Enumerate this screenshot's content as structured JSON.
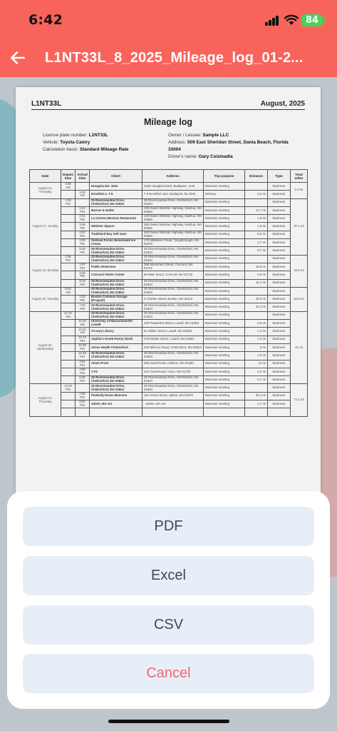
{
  "status": {
    "time": "6:42",
    "battery": "84"
  },
  "appbar": {
    "title": "L1NT33L_8_2025_Mileage_log_01-2..."
  },
  "doc": {
    "plate": "L1NT33L",
    "month": "August, 2025",
    "title": "Mileage log",
    "meta_left": [
      {
        "label": "License plate number: ",
        "value": "L1NT33L"
      },
      {
        "label": "Vehicle: ",
        "value": "Toyota Camry"
      },
      {
        "label": "Calculation basis: ",
        "value": "Standard Mileage Rate"
      }
    ],
    "meta_right": [
      {
        "label": "Owner / Lessee: ",
        "value": "Sample LLC"
      },
      {
        "label": "Address: ",
        "value": "509 East Sheridan Street, Dania Beach, Florida 33004"
      },
      {
        "label": "Driver's name: ",
        "value": "Gary Csizmadia"
      }
    ],
    "columns": [
      "Date",
      "Depart. time",
      "Arrival time",
      "Client",
      "Address",
      "Trip purpose",
      "Distance",
      "Type",
      "Total miles"
    ],
    "days": [
      {
        "date": "August 14, Thursday",
        "total": "3.3 mi",
        "rows": [
          [
            "2:38 AM",
            "Hungária krt. 163a",
            "163a Hungária körút, Budapest, 1146",
            "Business meeting",
            "",
            "Business"
          ],
          [
            "2:40 AM",
            "Erzsébet u. 7-9",
            "7-9 Erzsébet utca, Budapest, ba 1045",
            "Delivery",
            "3.3 mi",
            "Business"
          ]
        ]
      },
      {
        "date": "August 17, Sunday",
        "total": "37.1 mi",
        "rows": [
          [
            "1:08 PM",
            "25 Rivermeadow Drive, Chelmsford, MA 01824",
            "25 Rivermeadow Drive, Chelmsford, MA 01824",
            "Business meeting",
            "",
            "Business"
          ],
          [
            "1:24 PM",
            "Barnes & Noble",
            "235 Daniel Webster Highway, Nashua, NH 03060",
            "Business meeting",
            "11.7 mi",
            "Business"
          ],
          [
            "2:41 PM",
            "La Carreta Mexican Restaurant",
            "139 Daniel Webster Highway, Nashua, NH 03060",
            "Business meeting",
            "1.9 mi",
            "Business"
          ],
          [
            "3:48 PM",
            "Webster Square",
            "285 Daniel Webster Highway, Nashua, NH 03060",
            "Business meeting",
            "1.6 mi",
            "Business"
          ],
          [
            "4:22 PM",
            "Tradeland Buy Sell Save",
            "263 Daniel Webster Highway, Nashua, NH 03060",
            "Business meeting",
            "0.5 mi",
            "Business"
          ],
          [
            "4:39 PM",
            "Sullivan Farms Homemade Ice Cream",
            "170 Middlesex Road, Tyngsborough, MA 01879",
            "Business meeting",
            "2.7 mi",
            "Business"
          ],
          [
            "5:28 PM",
            "25 Rivermeadow Drive, Chelmsford, MA 01824",
            "25 Rivermeadow Drive, Chelmsford, MA 01824",
            "Business meeting",
            "8.7 mi",
            "Business"
          ]
        ]
      },
      {
        "date": "August 18, Monday",
        "total": "22.8 mi",
        "rows": [
          [
            "1:36 PM",
            "25 Rivermeadow Drive, Chelmsford, MA 01824",
            "25 Rivermeadow Drive, Chelmsford, MA 01824",
            "Business meeting",
            "",
            "Business"
          ],
          [
            "1:57 PM",
            "Public Restroom",
            "298 Monument Street, Concord, MA 01742",
            "Business meeting",
            "10.8 mi",
            "Business"
          ],
          [
            "2:26 PM",
            "Concord Visitor Center",
            "58 Main Street, Concord, MA 01742",
            "Business meeting",
            "0.9 mi",
            "Business"
          ],
          [
            "5:18 PM",
            "25 Rivermeadow Drive, Chelmsford, MA 01824",
            "25 Rivermeadow Drive, Chelmsford, MA 01824",
            "Business meeting",
            "11.1 mi",
            "Business"
          ]
        ]
      },
      {
        "date": "August 19, Tuesday",
        "total": "63.8 mi",
        "rows": [
          [
            "8:43 AM",
            "25 Rivermeadow Drive, Chelmsford, MA 01824",
            "25 Rivermeadow Drive, Chelmsford, MA 01824",
            "Business meeting",
            "",
            "Business"
          ],
          [
            "1:03 PM",
            "Boston Common Garage (Propark)",
            "0 Charles Street, Boston, MA 02116",
            "Business meeting",
            "32.6 mi",
            "Business"
          ],
          [
            "7:02 PM",
            "25 Rivermeadow Drive, Chelmsford, MA 01824",
            "25 Rivermeadow Drive, Chelmsford, MA 01824",
            "Business meeting",
            "31.2 mi",
            "Business"
          ]
        ]
      },
      {
        "date": "August 20, Wednesday",
        "total": "41 mi",
        "rows": [
          [
            "11:10 AM",
            "25 Rivermeadow Drive, Chelmsford, MA 01824",
            "25 Rivermeadow Drive, Chelmsford, MA 01824",
            "Business meeting",
            "",
            "Business"
          ],
          [
            "11:20 AM",
            "University of Massachusetts Lowell",
            "220 Pawtucket Street, Lowell, MA 01854",
            "Business meeting",
            "6.5 mi",
            "Business"
          ],
          [
            "11:54 AM",
            "O'Leary Library",
            "61 Wilder Street, Lowell, MA 01854",
            "Business meeting",
            "1.4 mi",
            "Business"
          ],
          [
            "12:13 PM",
            "Sophia's Greek Pantry North",
            "478 Market Street, Lowell, MA 01854",
            "Business meeting",
            "1.3 mi",
            "Business"
          ],
          [
            "12:39 PM",
            "Atrius Health Chelmsford",
            "228 Billerica Road, Chelmsford, MA 01824",
            "Business meeting",
            "6 mi",
            "Business"
          ],
          [
            "12:45 PM",
            "25 Rivermeadow Drive, Chelmsford, MA 01824",
            "25 Rivermeadow Drive, Chelmsford, MA 01824",
            "Business meeting",
            "1.9 mi",
            "Business"
          ],
          [
            "2:51 PM",
            "Amari Prom",
            "256 Great Road, Littleton, MA 01460",
            "Business meeting",
            "11 mi",
            "Business"
          ],
          [
            "4:08 PM",
            "CVS",
            "344 Great Road, Acton, MA 01720",
            "Business meeting",
            "4.2 mi",
            "Business"
          ],
          [
            "5:28 PM",
            "25 Rivermeadow Drive, Chelmsford, MA 01824",
            "25 Rivermeadow Drive, Chelmsford, MA 01824",
            "Business meeting",
            "8.7 mi",
            "Business"
          ]
        ]
      },
      {
        "date": "August 21, Thursday",
        "total": "71.1 mi",
        "rows": [
          [
            "12:02 PM",
            "25 Rivermeadow Drive, Chelmsford, MA 01824",
            "25 Rivermeadow Drive, Chelmsford, MA 01824",
            "Business meeting",
            "",
            "Business"
          ],
          [
            "1:50 PM",
            "Peabody Essex Museum",
            "161 Essex Street, Salem, MA 01970",
            "Business meeting",
            "34.4 mi",
            "Business"
          ],
          [
            "5:02 PM",
            "Salem, MA n/a",
            ", Salem, MA n/a",
            "Business meeting",
            "1.7 mi",
            "Business"
          ],
          [
            "",
            "",
            "",
            "",
            "",
            ""
          ]
        ]
      }
    ]
  },
  "sheet": {
    "options": [
      {
        "label": "PDF"
      },
      {
        "label": "Excel"
      },
      {
        "label": "CSV"
      }
    ],
    "cancel": "Cancel"
  },
  "colors": {
    "accent": "#f8645b",
    "option_bg": "#e7eef7",
    "cancel": "#f5646b"
  }
}
